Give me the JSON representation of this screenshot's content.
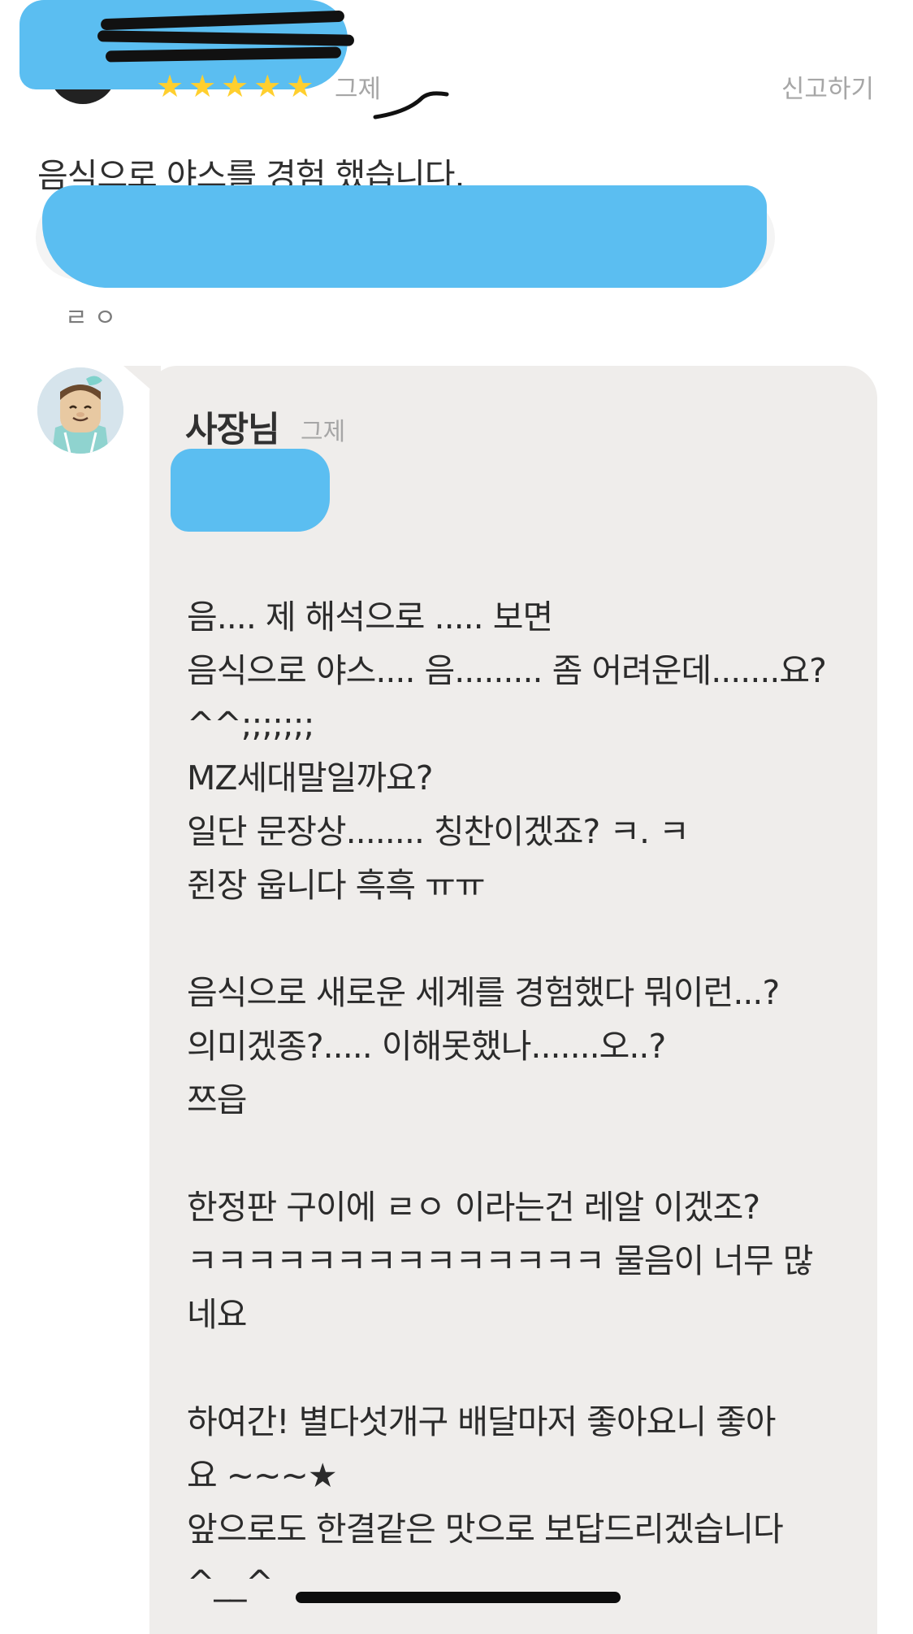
{
  "review": {
    "stars": [
      "★",
      "★",
      "★",
      "★",
      "★"
    ],
    "rating": 5,
    "date": "그제",
    "report_label": "신고하기",
    "text": "음식으로 야스를 경험 했습니다.",
    "menu_caption": "ㄹㅇ"
  },
  "reply": {
    "author": "사장님",
    "date": "그제",
    "lines": [
      "음.... 제 해석으로 ..... 보면",
      "음식으로 야스.... 음......... 좀 어려운데.......요?",
      "^^;;;;;;;",
      "MZ세대말일까요?",
      "일단 문장상........ 칭찬이겠죠? ㅋ. ㅋ",
      "쥔장 웁니다 흑흑 ㅠㅠ",
      "",
      "음식으로 새로운 세계를 경험했다 뭐이런...?",
      "의미겠종?..... 이해못했나.......오..?",
      "쯔읍",
      "",
      "한정판 구이에 ㄹㅇ 이라는건 레알 이겠조?",
      "ㅋㅋㅋㅋㅋㅋㅋㅋㅋㅋㅋㅋㅋㅋ 물음이 너무 많",
      "네요",
      "",
      "하여간! 별다섯개구 배달마저 좋아요니 좋아",
      "요 ~~~★",
      "앞으로도 한결같은 맛으로 보답드리겠습니다",
      "^__^"
    ]
  },
  "colors": {
    "redaction": "#5bbef1",
    "star": "#ffcf2e",
    "bubble": "#efedeb"
  }
}
